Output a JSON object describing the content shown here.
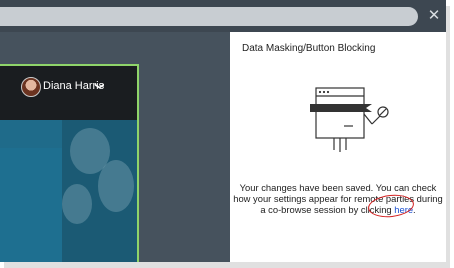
{
  "window": {
    "close_icon": "✕"
  },
  "shared_app": {
    "user_name": "Diana Harris",
    "user_menu_icon": "chevron-down",
    "user_menu_glyph": "❯"
  },
  "panel": {
    "title": "Data Masking/Button Blocking",
    "message_before_link": "Your changes have been saved. You can check how your settings appear for remote parties during a co-browse session by clicking ",
    "link_text": "here",
    "message_after_link": "."
  },
  "colors": {
    "frame": "#4f5a66",
    "preview_border": "#8fd46a",
    "link": "#1a4fd0",
    "annotation": "#d32020"
  }
}
